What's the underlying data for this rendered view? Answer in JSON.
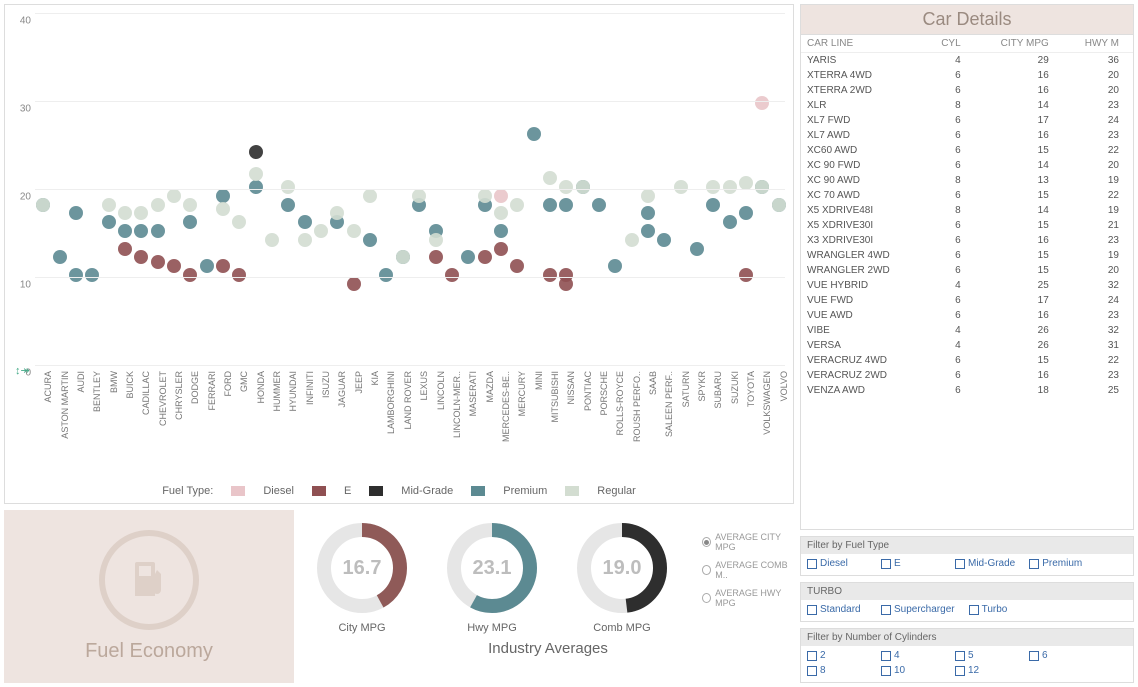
{
  "chart_data": {
    "type": "scatter",
    "title": "",
    "xlabel": "",
    "ylabel": "",
    "ylim": [
      0,
      40
    ],
    "yticks": [
      0,
      10,
      20,
      30,
      40
    ],
    "categories": [
      "ACURA",
      "ASTON MARTIN",
      "AUDI",
      "BENTLEY",
      "BMW",
      "BUICK",
      "CADILLAC",
      "CHEVROLET",
      "CHRYSLER",
      "DODGE",
      "FERRARI",
      "FORD",
      "GMC",
      "HONDA",
      "HUMMER",
      "HYUNDAI",
      "INFINITI",
      "ISUZU",
      "JAGUAR",
      "JEEP",
      "KIA",
      "LAMBORGHINI",
      "LAND ROVER",
      "LEXUS",
      "LINCOLN",
      "LINCOLN-MER..",
      "MASERATI",
      "MAZDA",
      "MERCEDES-BE..",
      "MERCURY",
      "MINI",
      "MITSUBISHI",
      "NISSAN",
      "PONTIAC",
      "PORSCHE",
      "ROLLS-ROYCE",
      "ROUSH PERFO..",
      "SAAB",
      "SALEEN PERF..",
      "SATURN",
      "SPYKR",
      "SUBARU",
      "SUZUKI",
      "TOYOTA",
      "VOLKSWAGEN",
      "VOLVO"
    ],
    "fuel_colors": {
      "Diesel": "#e9c5c9",
      "E": "#8f5052",
      "Mid-Grade": "#2e2e2e",
      "Premium": "#5c8a92",
      "Regular": "#d3ddd1"
    },
    "series": [
      {
        "name": "Diesel",
        "points": [
          {
            "cat": "MERCEDES-BE..",
            "y": 19
          },
          {
            "cat": "VOLKSWAGEN",
            "y": 29.5
          }
        ]
      },
      {
        "name": "E",
        "points": [
          {
            "cat": "BUICK",
            "y": 13
          },
          {
            "cat": "CADILLAC",
            "y": 12
          },
          {
            "cat": "CHEVROLET",
            "y": 11.5
          },
          {
            "cat": "CHRYSLER",
            "y": 11
          },
          {
            "cat": "DODGE",
            "y": 10
          },
          {
            "cat": "FORD",
            "y": 11
          },
          {
            "cat": "GMC",
            "y": 10
          },
          {
            "cat": "JEEP",
            "y": 9
          },
          {
            "cat": "LINCOLN",
            "y": 12
          },
          {
            "cat": "LINCOLN-MER..",
            "y": 10
          },
          {
            "cat": "MAZDA",
            "y": 12
          },
          {
            "cat": "MERCEDES-BE..",
            "y": 13
          },
          {
            "cat": "MERCURY",
            "y": 11
          },
          {
            "cat": "MITSUBISHI",
            "y": 10
          },
          {
            "cat": "NISSAN",
            "y": 9
          },
          {
            "cat": "NISSAN",
            "y": 10
          },
          {
            "cat": "TOYOTA",
            "y": 10
          }
        ]
      },
      {
        "name": "Mid-Grade",
        "points": [
          {
            "cat": "HONDA",
            "y": 24
          }
        ]
      },
      {
        "name": "Premium",
        "points": [
          {
            "cat": "ACURA",
            "y": 18
          },
          {
            "cat": "ASTON MARTIN",
            "y": 12
          },
          {
            "cat": "AUDI",
            "y": 17
          },
          {
            "cat": "AUDI",
            "y": 10
          },
          {
            "cat": "BENTLEY",
            "y": 10
          },
          {
            "cat": "BMW",
            "y": 16
          },
          {
            "cat": "BUICK",
            "y": 15
          },
          {
            "cat": "CADILLAC",
            "y": 15
          },
          {
            "cat": "CHEVROLET",
            "y": 15
          },
          {
            "cat": "DODGE",
            "y": 16
          },
          {
            "cat": "FERRARI",
            "y": 11
          },
          {
            "cat": "FORD",
            "y": 19
          },
          {
            "cat": "HONDA",
            "y": 20
          },
          {
            "cat": "HYUNDAI",
            "y": 18
          },
          {
            "cat": "INFINITI",
            "y": 16
          },
          {
            "cat": "JAGUAR",
            "y": 16
          },
          {
            "cat": "KIA",
            "y": 14
          },
          {
            "cat": "LAMBORGHINI",
            "y": 10
          },
          {
            "cat": "LAND ROVER",
            "y": 12
          },
          {
            "cat": "LEXUS",
            "y": 18
          },
          {
            "cat": "LINCOLN",
            "y": 15
          },
          {
            "cat": "MASERATI",
            "y": 12
          },
          {
            "cat": "MAZDA",
            "y": 18
          },
          {
            "cat": "MERCEDES-BE..",
            "y": 15
          },
          {
            "cat": "MINI",
            "y": 26
          },
          {
            "cat": "MITSUBISHI",
            "y": 18
          },
          {
            "cat": "NISSAN",
            "y": 18
          },
          {
            "cat": "PONTIAC",
            "y": 20
          },
          {
            "cat": "PORSCHE",
            "y": 18
          },
          {
            "cat": "ROLLS-ROYCE",
            "y": 11
          },
          {
            "cat": "SAAB",
            "y": 17
          },
          {
            "cat": "SAAB",
            "y": 15
          },
          {
            "cat": "SALEEN PERF..",
            "y": 14
          },
          {
            "cat": "SPYKR",
            "y": 13
          },
          {
            "cat": "SUBARU",
            "y": 18
          },
          {
            "cat": "SUZUKI",
            "y": 16
          },
          {
            "cat": "TOYOTA",
            "y": 17
          },
          {
            "cat": "VOLKSWAGEN",
            "y": 20
          },
          {
            "cat": "VOLVO",
            "y": 18
          }
        ]
      },
      {
        "name": "Regular",
        "points": [
          {
            "cat": "ACURA",
            "y": 18
          },
          {
            "cat": "BMW",
            "y": 18
          },
          {
            "cat": "BUICK",
            "y": 17
          },
          {
            "cat": "CADILLAC",
            "y": 17
          },
          {
            "cat": "CHEVROLET",
            "y": 18
          },
          {
            "cat": "CHRYSLER",
            "y": 19
          },
          {
            "cat": "DODGE",
            "y": 18
          },
          {
            "cat": "FORD",
            "y": 17.5
          },
          {
            "cat": "GMC",
            "y": 16
          },
          {
            "cat": "HONDA",
            "y": 21.5
          },
          {
            "cat": "HUMMER",
            "y": 14
          },
          {
            "cat": "HYUNDAI",
            "y": 20
          },
          {
            "cat": "INFINITI",
            "y": 14
          },
          {
            "cat": "ISUZU",
            "y": 15
          },
          {
            "cat": "JAGUAR",
            "y": 17
          },
          {
            "cat": "JEEP",
            "y": 15
          },
          {
            "cat": "KIA",
            "y": 19
          },
          {
            "cat": "LAND ROVER",
            "y": 12
          },
          {
            "cat": "LEXUS",
            "y": 19
          },
          {
            "cat": "LINCOLN",
            "y": 14
          },
          {
            "cat": "MAZDA",
            "y": 19
          },
          {
            "cat": "MERCEDES-BE..",
            "y": 17
          },
          {
            "cat": "MERCURY",
            "y": 18
          },
          {
            "cat": "MITSUBISHI",
            "y": 21
          },
          {
            "cat": "NISSAN",
            "y": 20
          },
          {
            "cat": "PONTIAC",
            "y": 20
          },
          {
            "cat": "ROUSH PERFO..",
            "y": 14
          },
          {
            "cat": "SAAB",
            "y": 19
          },
          {
            "cat": "SATURN",
            "y": 20
          },
          {
            "cat": "SUBARU",
            "y": 20
          },
          {
            "cat": "SUZUKI",
            "y": 20
          },
          {
            "cat": "TOYOTA",
            "y": 20.5
          },
          {
            "cat": "VOLKSWAGEN",
            "y": 20
          },
          {
            "cat": "VOLVO",
            "y": 18
          }
        ]
      }
    ],
    "legend_title": "Fuel Type:",
    "legend": [
      "Diesel",
      "E",
      "Mid-Grade",
      "Premium",
      "Regular"
    ]
  },
  "car_details": {
    "title": "Car Details",
    "columns": [
      "CAR LINE",
      "CYL",
      "CITY MPG",
      "HWY M"
    ],
    "rows": [
      [
        "YARIS",
        4,
        29,
        36
      ],
      [
        "XTERRA 4WD",
        6,
        16,
        20
      ],
      [
        "XTERRA 2WD",
        6,
        16,
        20
      ],
      [
        "XLR",
        8,
        14,
        23
      ],
      [
        "XL7 FWD",
        6,
        17,
        24
      ],
      [
        "XL7 AWD",
        6,
        16,
        23
      ],
      [
        "XC60 AWD",
        6,
        15,
        22
      ],
      [
        "XC 90 FWD",
        6,
        14,
        20
      ],
      [
        "XC 90 AWD",
        8,
        13,
        19
      ],
      [
        "XC 70 AWD",
        6,
        15,
        22
      ],
      [
        "X5 XDRIVE48I",
        8,
        14,
        19
      ],
      [
        "X5 XDRIVE30I",
        6,
        15,
        21
      ],
      [
        "X3 XDRIVE30I",
        6,
        16,
        23
      ],
      [
        "WRANGLER 4WD",
        6,
        15,
        19
      ],
      [
        "WRANGLER 2WD",
        6,
        15,
        20
      ],
      [
        "VUE HYBRID",
        4,
        25,
        32
      ],
      [
        "VUE FWD",
        6,
        17,
        24
      ],
      [
        "VUE AWD",
        6,
        16,
        23
      ],
      [
        "VIBE",
        4,
        26,
        32
      ],
      [
        "VERSA",
        4,
        26,
        31
      ],
      [
        "VERACRUZ 4WD",
        6,
        15,
        22
      ],
      [
        "VERACRUZ 2WD",
        6,
        16,
        23
      ],
      [
        "VENZA AWD",
        6,
        18,
        25
      ]
    ]
  },
  "averages": {
    "title": "Industry Averages",
    "donuts": [
      {
        "label": "City MPG",
        "value": "16.7",
        "pct": 0.42,
        "color": "#8f5a58"
      },
      {
        "label": "Hwy MPG",
        "value": "23.1",
        "pct": 0.58,
        "color": "#5c8a92"
      },
      {
        "label": "Comb MPG",
        "value": "19.0",
        "pct": 0.48,
        "color": "#2e2e2e"
      }
    ],
    "legend": [
      {
        "label": "AVERAGE CITY MPG",
        "on": true
      },
      {
        "label": "AVERAGE COMB M..",
        "on": false
      },
      {
        "label": "AVERAGE HWY MPG",
        "on": false
      }
    ]
  },
  "fuel_econ_tile": {
    "title": "Fuel Economy"
  },
  "filters": {
    "fuel": {
      "title": "Filter by Fuel Type",
      "items": [
        "Diesel",
        "E",
        "Mid-Grade",
        "Premium"
      ]
    },
    "turbo": {
      "title": "TURBO",
      "items": [
        "Standard",
        "Supercharger",
        "Turbo"
      ]
    },
    "cyl": {
      "title": "Filter by Number of Cylinders",
      "items": [
        "2",
        "4",
        "5",
        "6",
        "8",
        "10",
        "12"
      ]
    }
  }
}
